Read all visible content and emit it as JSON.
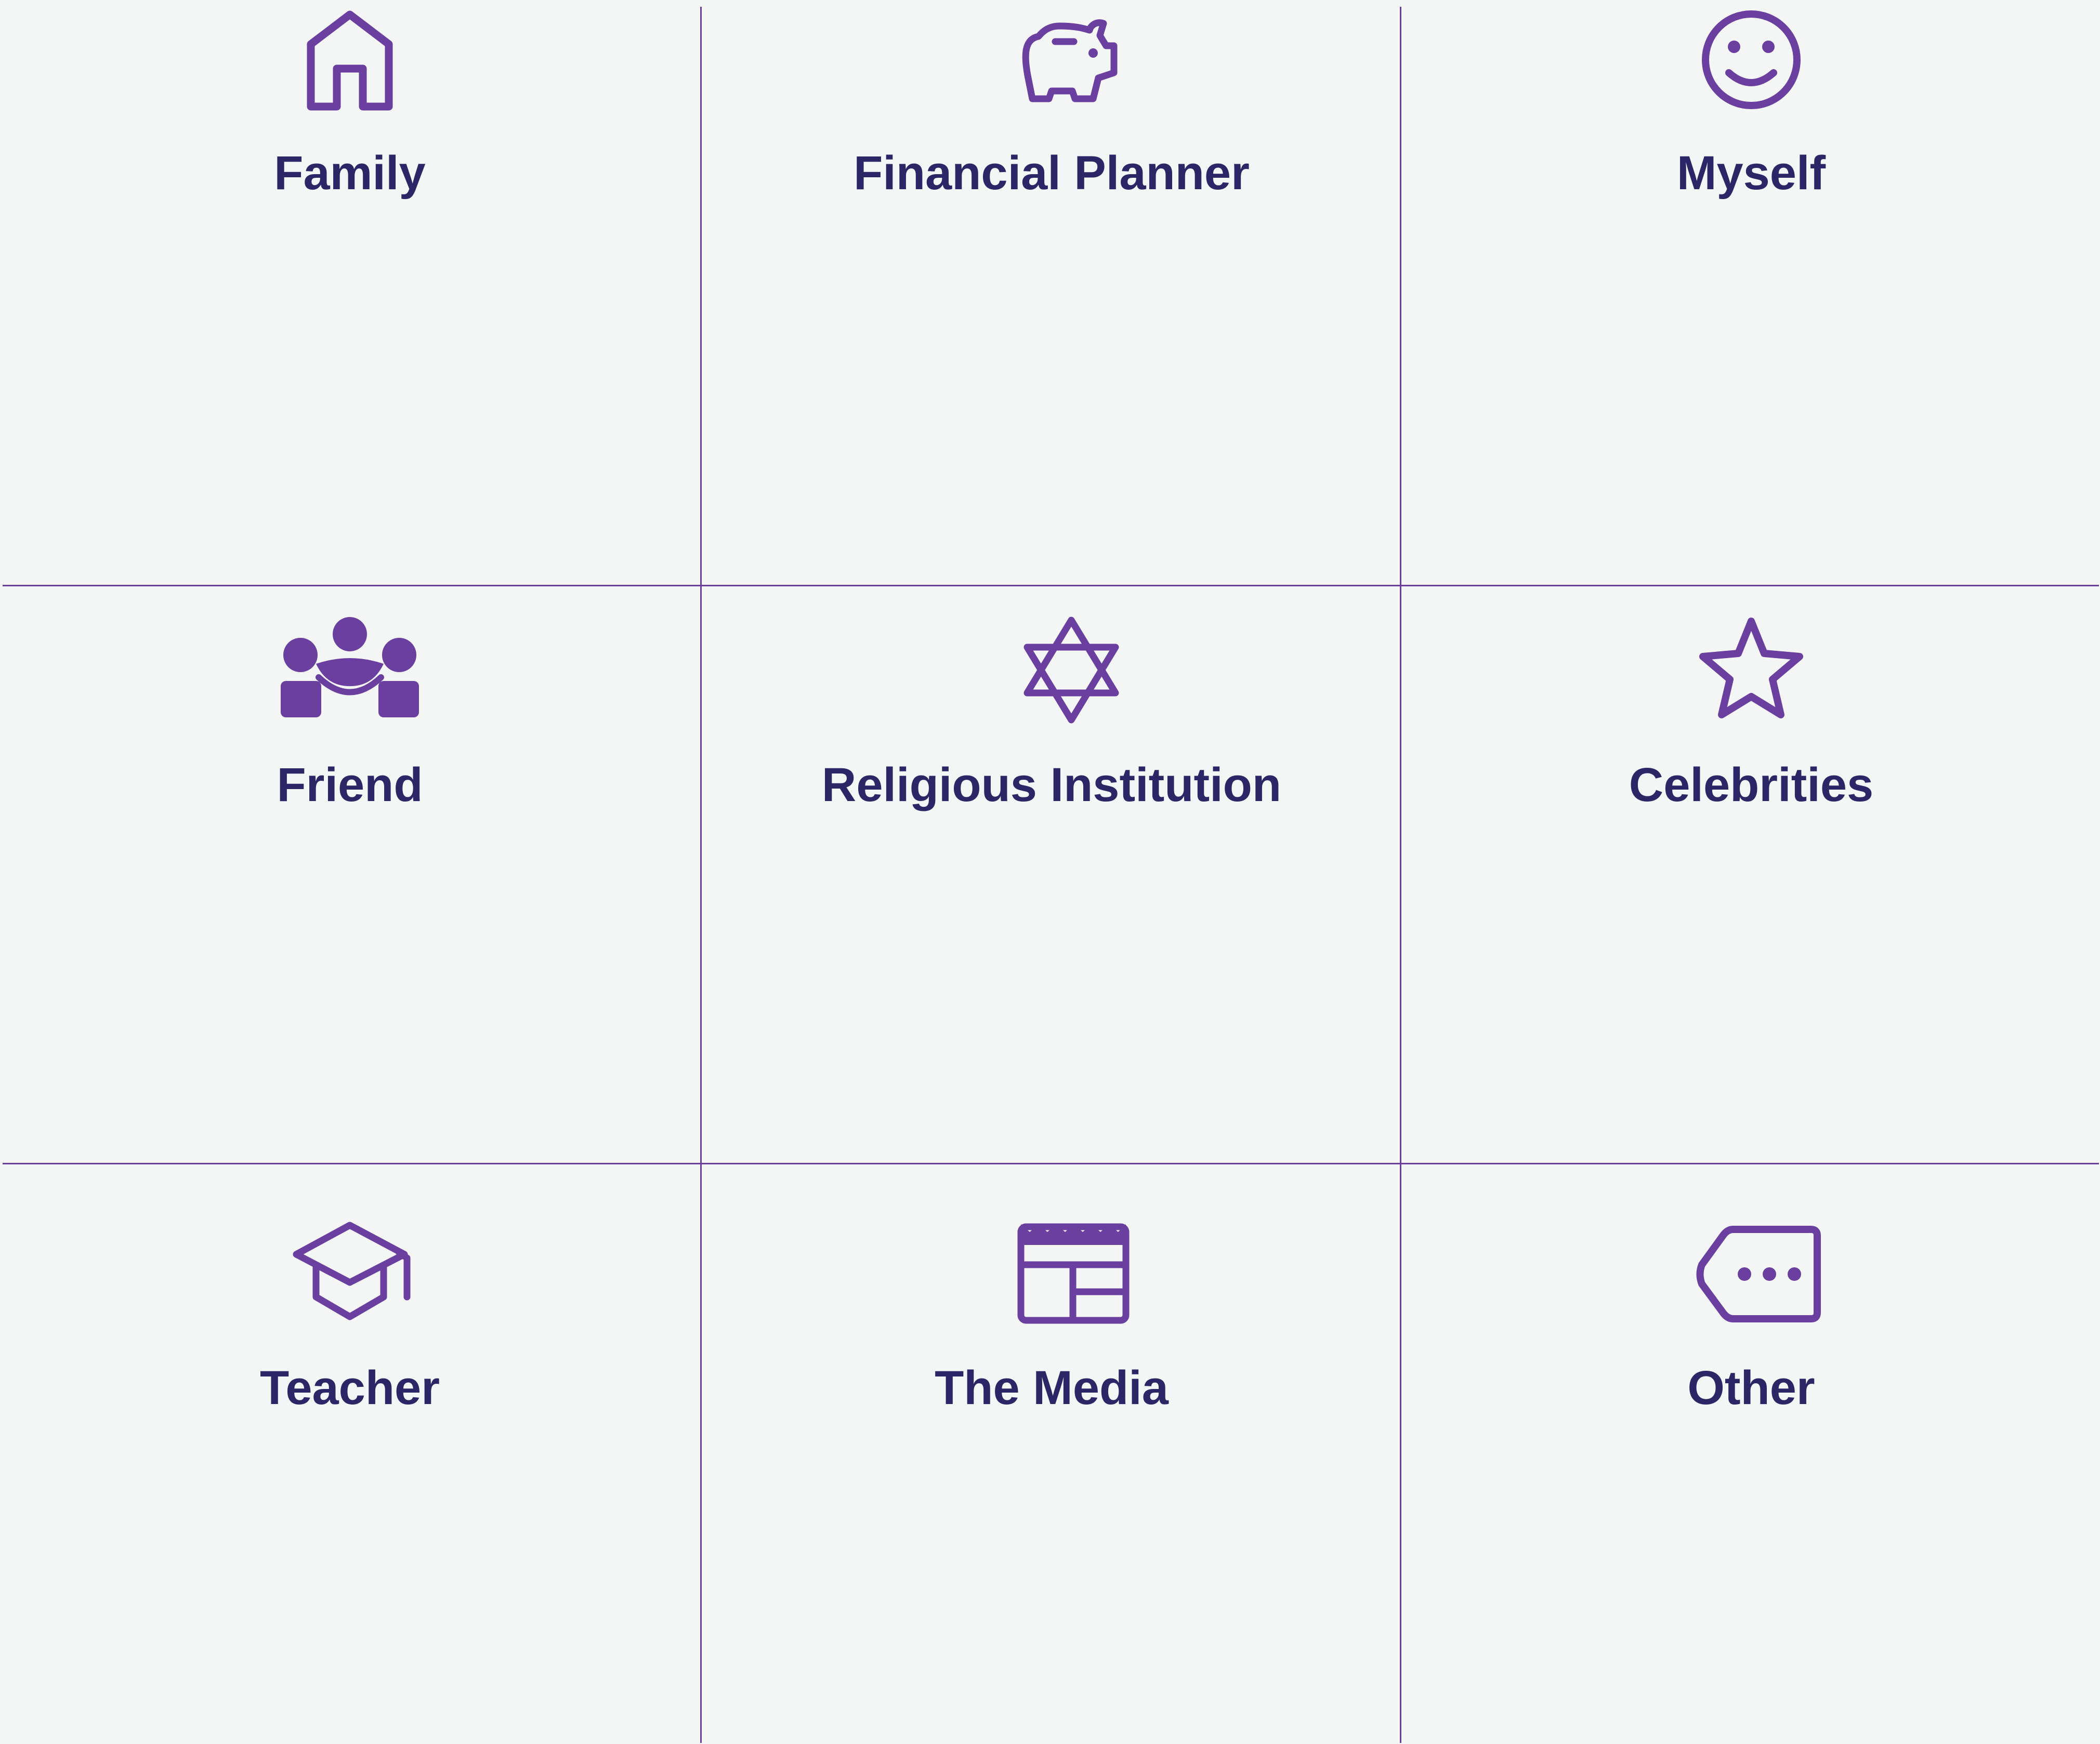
{
  "colors": {
    "background": "#f4f6f5",
    "accent": "#6b3fa0",
    "label": "#2b2767"
  },
  "options": [
    {
      "label": "Family",
      "icon": "house-icon"
    },
    {
      "label": "Financial Planner",
      "icon": "piggy-bank-icon"
    },
    {
      "label": "Myself",
      "icon": "smiley-face-icon"
    },
    {
      "label": "Friend",
      "icon": "people-group-icon"
    },
    {
      "label": "Religious Institution",
      "icon": "star-of-david-icon"
    },
    {
      "label": "Celebrities",
      "icon": "star-icon"
    },
    {
      "label": "Teacher",
      "icon": "graduation-cap-icon"
    },
    {
      "label": "The Media",
      "icon": "newspaper-icon"
    },
    {
      "label": "Other",
      "icon": "tag-more-icon"
    }
  ]
}
